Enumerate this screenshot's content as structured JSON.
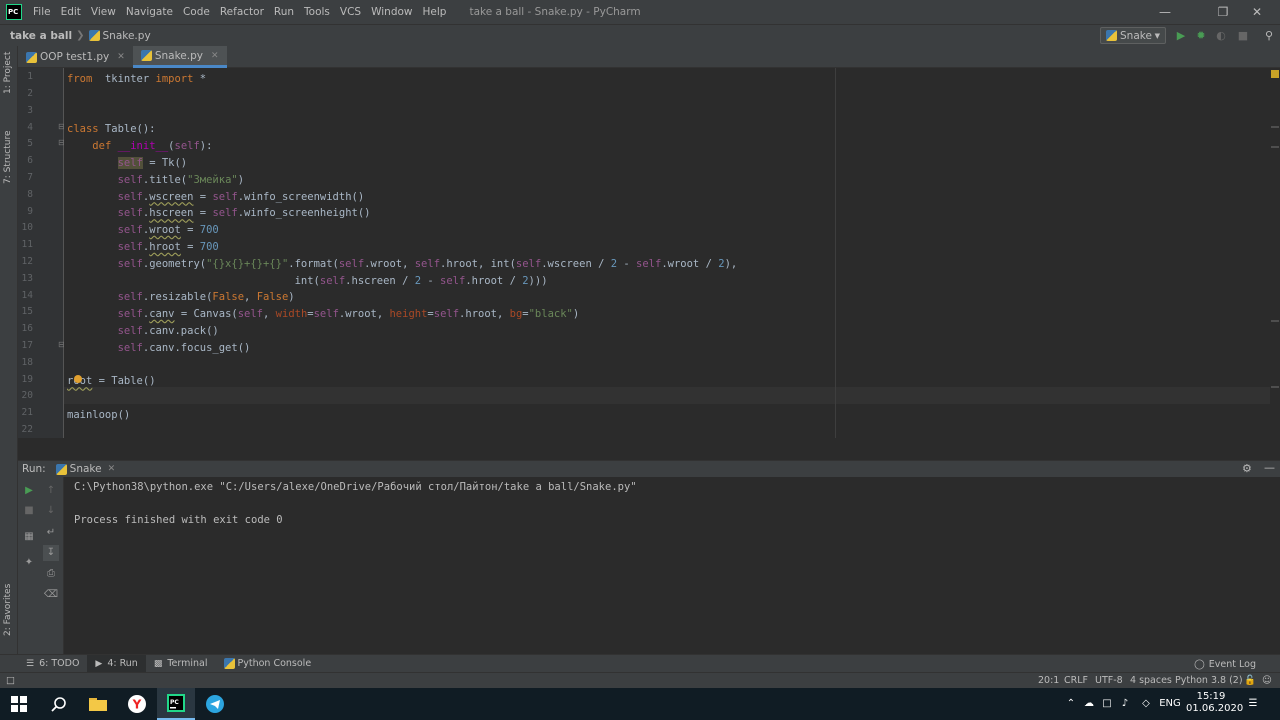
{
  "app": {
    "logo_text": "PC",
    "window_title": "take a ball - Snake.py - PyCharm",
    "menu": [
      "File",
      "Edit",
      "View",
      "Navigate",
      "Code",
      "Refactor",
      "Run",
      "Tools",
      "VCS",
      "Window",
      "Help"
    ]
  },
  "navbar": {
    "project": "take a ball",
    "file": "Snake.py",
    "run_config": "Snake"
  },
  "left_stripe": {
    "project": "1: Project",
    "structure": "7: Structure",
    "favorites": "2: Favorites"
  },
  "tabs": [
    {
      "label": "OOP test1.py",
      "active": false
    },
    {
      "label": "Snake.py",
      "active": true
    }
  ],
  "editor": {
    "line_numbers": [
      "1",
      "2",
      "3",
      "4",
      "5",
      "6",
      "7",
      "8",
      "9",
      "10",
      "11",
      "12",
      "13",
      "14",
      "15",
      "16",
      "17",
      "18",
      "19",
      "20",
      "21",
      "22"
    ],
    "caret_line": 20
  },
  "run_panel": {
    "label": "Run:",
    "tab": "Snake",
    "lines": [
      "C:\\Python38\\python.exe \"C:/Users/alexe/OneDrive/Рабочий стол/Пайтон/take a ball/Snake.py\"",
      "",
      "Process finished with exit code 0"
    ]
  },
  "toolwindows": {
    "todo": "6: TODO",
    "run": "4: Run",
    "terminal": "Terminal",
    "python_console": "Python Console",
    "event_log": "Event Log"
  },
  "status": {
    "position": "20:1",
    "line_sep": "CRLF",
    "encoding": "UTF-8",
    "indent": "4 spaces",
    "interpreter": "Python 3.8 (2)"
  },
  "taskbar": {
    "lang": "ENG",
    "time": "15:19",
    "date": "01.06.2020"
  },
  "colors": {
    "accent": "#4a88c7",
    "run_green": "#499c54",
    "keyword": "#cc7832",
    "self": "#94558d",
    "string": "#6a8759",
    "number": "#6897bb"
  }
}
